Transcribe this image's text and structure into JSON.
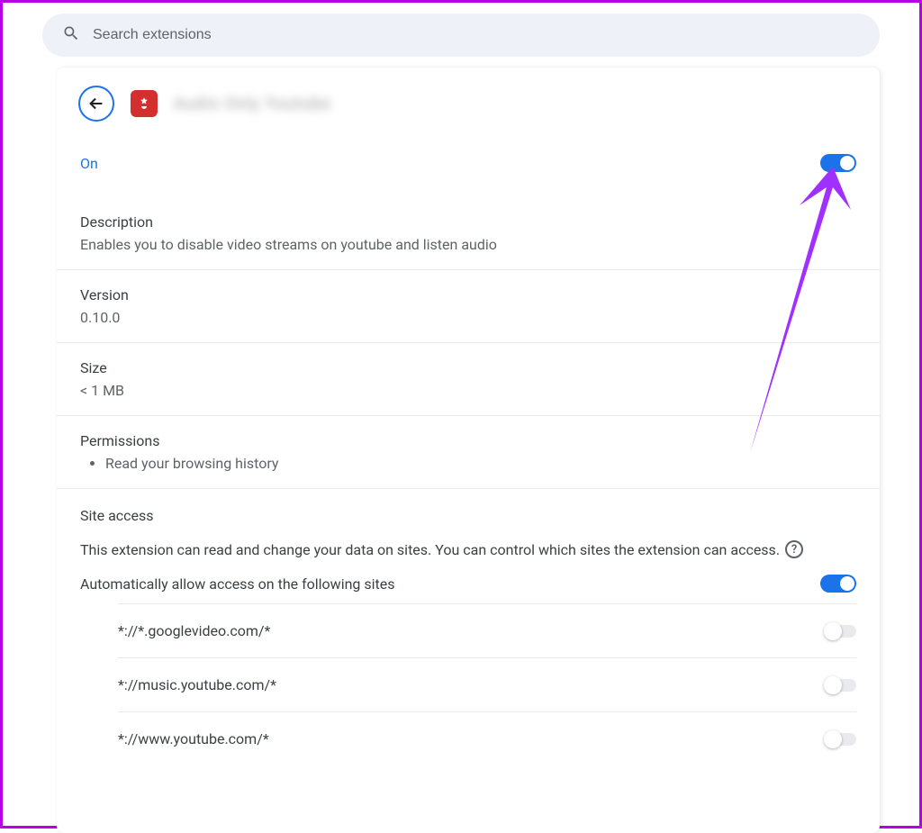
{
  "search": {
    "placeholder": "Search extensions"
  },
  "extension": {
    "name_blurred": "Audio Only Youtube",
    "status_label": "On",
    "status_on": true
  },
  "description": {
    "heading": "Description",
    "text": "Enables you to disable video streams on youtube and listen audio"
  },
  "version": {
    "heading": "Version",
    "value": "0.10.0"
  },
  "size": {
    "heading": "Size",
    "value": "< 1 MB"
  },
  "permissions": {
    "heading": "Permissions",
    "items": [
      "Read your browsing history"
    ]
  },
  "site_access": {
    "heading": "Site access",
    "description": "This extension can read and change your data on sites. You can control which sites the extension can access.",
    "auto_allow_label": "Automatically allow access on the following sites",
    "auto_allow_on": true,
    "sites": [
      {
        "pattern": "*://*.googlevideo.com/*",
        "on": false
      },
      {
        "pattern": "*://music.youtube.com/*",
        "on": false
      },
      {
        "pattern": "*://www.youtube.com/*",
        "on": false
      }
    ]
  },
  "colors": {
    "accent": "#1a73e8",
    "annotation": "#a030ff",
    "border": "#b800e6"
  }
}
